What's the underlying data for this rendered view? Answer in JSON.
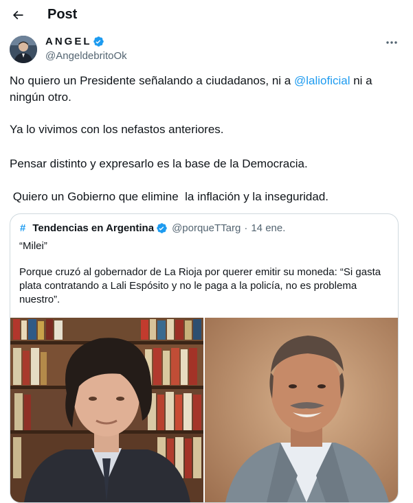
{
  "header": {
    "title": "Post",
    "back_icon": "arrow-left-icon"
  },
  "author": {
    "name": "ANGEL",
    "handle": "@AngeldebritoOk",
    "verified_color": "#1d9bf0",
    "more_icon": "ellipsis-icon"
  },
  "tweet": {
    "line1_pre": "No quiero un Presidente señalando a ciudadanos, ni a ",
    "line1_mention": "@lalioficial",
    "line1_post": " ni a ningún otro.",
    "para2": "Ya lo vivimos con los nefastos anteriores.",
    "para3": "Pensar distinto y expresarlo es la base de la Democracia.",
    "para4": " Quiero un Gobierno que elimine  la inflación y la inseguridad."
  },
  "quote": {
    "hash": "#",
    "name": "Tendencias en Argentina",
    "handle": "@porqueTTarg",
    "separator": "·",
    "date": "14 ene.",
    "text1": "“Milei”",
    "text2": "Porque cruzó al gobernador de La Rioja por querer emitir su moneda: “Si gasta plata contratando a Lali Espósito y no le paga a la policía, no es problema nuestro”."
  },
  "colors": {
    "accent": "#1d9bf0",
    "text": "#0f1419",
    "secondary": "#536471",
    "border": "#cfd9de"
  }
}
